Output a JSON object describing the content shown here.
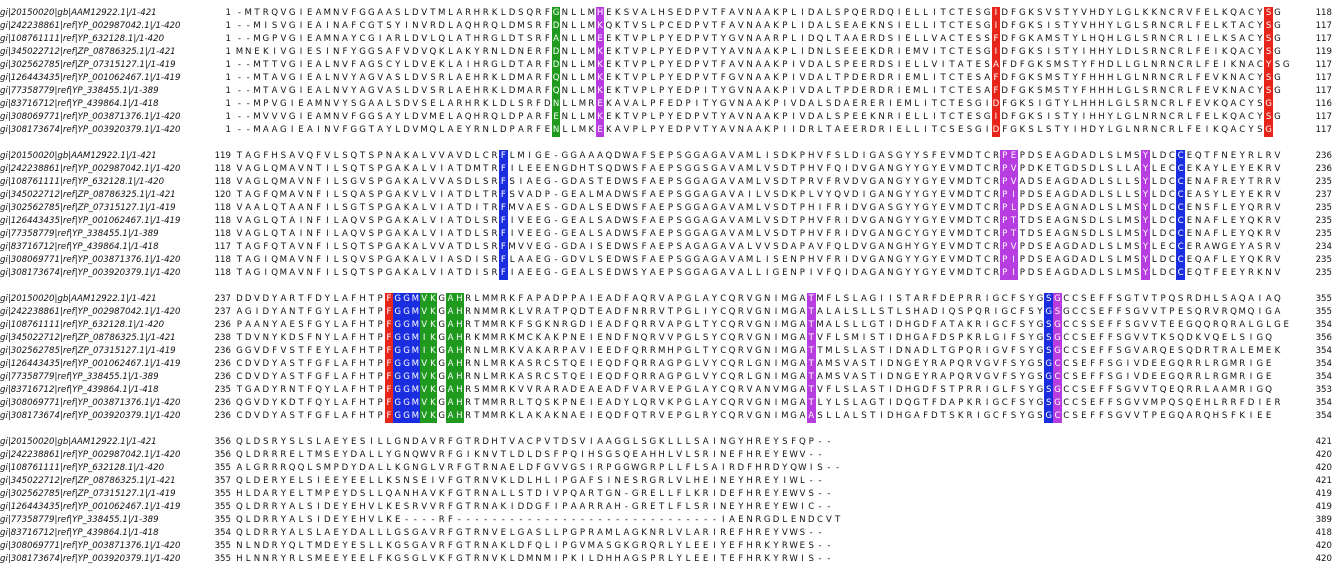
{
  "colors": {
    "background": "#ffffff",
    "text": "#111111",
    "highlight_text": "#ffffff",
    "conservation": {
      "R": "#e8251a",
      "D": "#e8251a",
      "E": "#e8251a",
      "C": "#e8251a",
      "F": "#1a2ee0",
      "Y": "#1a2ee0",
      "G": "#1f9a1f",
      "N": "#b73de0",
      "S": "#b73de0",
      "T": "#b73de0",
      "M": "#b73de0",
      "P": "#1a2ee0",
      "H": "#e8251a",
      "K": "#1f9a1f",
      "V": "#1f9a1f",
      "L": "#b73de0"
    }
  },
  "alignment": {
    "blocks": [
      {
        "highlight": [
          {
            "col": 36,
            "color": "#1f9a1f"
          },
          {
            "col": 41,
            "color": "#b73de0"
          },
          {
            "col": 86,
            "color": "#e8251a"
          },
          {
            "col": 117,
            "color": "#e8251a"
          }
        ],
        "rows": [
          {
            "name": "gi|20150020|gb|AAM12922.1|/1-421",
            "start": "1",
            "seq": "-MTRQVGIEAMNVFGGAASLDVTMLARHRKLDSQRFGNLLMHEKSVALHSEDPVTFAVNAAKPLIDALSPQERDQIELLITCTESGIDFGKSVSTYVHDYLGLKKNCRVFELKQACYSG",
            "end": "118"
          },
          {
            "name": "gi|242238861|ref|YP_002987042.1|/1-420",
            "start": "1",
            "seq": "--MISVGIEAINAFCGTSYINVRDLAQHRQLDMSRFDNLLMKQKTVSLPCEDPVTFAVNAAKPLIDALSEAEKNSIELLITCTESGIDFGKSISTYVHHYLGLSRNCRLFELKTACYSG",
            "end": "117"
          },
          {
            "name": "gi|108761111|ref|YP_632128.1|/1-420",
            "start": "1",
            "seq": "--MGPVGIEAMNAYCGIARLDVLQLATHRGLDTSRFANLLMEEKTVPLPYEDPVTYGVNAARPLIDQLTAAERDSIELLVACTESSFDFGKAMSTYLHQHLGLSRNCRLIELKSACYSG",
            "end": "117"
          },
          {
            "name": "gi|345022712|ref|ZP_08786325.1|/1-421",
            "start": "1",
            "seq": "MNEKIVGIESINFYGGSAFVDVQKLAKYRNLDNERFDNLLMKEKTVPLPYEDPVTYAVNAAKPLIDNLSEEEKDRIEMVITCTESGIDFGKSISTYIHHYLDLSRNCRLFEIKQACYSG",
            "end": "119"
          },
          {
            "name": "gi|302562785|ref|ZP_07315127.1|/1-419",
            "start": "1",
            "seq": "--MTTVGIEALNVFAGSCYLDVEKLAIHRGLDTARFDNLLMKEKTVPLPYEDPVTFAVNAAKPIVDALSPEERDSIELLVITATESAFDFGKSMSTYFHDLLGLNRNCRLFEIKNACYSG",
            "end": "117"
          },
          {
            "name": "gi|126443435|ref|YP_001062467.1|/1-419",
            "start": "1",
            "seq": "--MTAVGIEALNVYAGVASLDVSRLAEHRKLDMARFQNLLMKEKTVPLPYEDPVTFGVNAAKPIVDALTPDERDRIEMLITCTESAFDFGKSMSTYFHHHLGLNRNCRLFEVKNACYSG",
            "end": "117"
          },
          {
            "name": "gi|77358779|ref|YP_338455.1|/1-389",
            "start": "1",
            "seq": "--MTAVGIEALNVYAGVASLDVSRLAEHRKLDMARFQNLLMKEKTVPLPYEDPITYGVNAAKPIVDALTPDERDRIEMLITCTESAFDFGKSMSTYFHHHLGLSRNCRLFEVKNACYSG",
            "end": "117"
          },
          {
            "name": "gi|83716712|ref|YP_439864.1|/1-418",
            "start": "1",
            "seq": "--MPVGIEAMNVYSGAALSDVSELARHRKLDLSRFDNLLMREKAVALPFEDPITYGVNAAKPIVDALSDAERERIEMLITCTESGIDFGKSIGTYLHHHLGLSRNCRLFEVKQACYSG",
            "end": "116"
          },
          {
            "name": "gi|308069771|ref|YP_003871376.1|/1-420",
            "start": "1",
            "seq": "--MVVVGIEAMNVFGGSAYLDVMELAQHRQLDPARFENLLMKEKTVPLPYEDPVTYAVNAAKPIVDALSPEEKNRIELLITCTESGIDFGKSISTYIHHYLGLNRNCRLFELKQACYSG",
            "end": "117"
          },
          {
            "name": "gi|308173674|ref|YP_003920379.1|/1-420",
            "start": "1",
            "seq": "--MAAGIEAINVFGGTAYLDVMQLAEYRNLDPARFENLLMKEKAVPLPYEDPVTYAVNAAKPIIDRLTAEERDRIELLITCSESGIDFGKSLSTYIHDYLGLNRNCRLFEIKQACYSG",
            "end": "117"
          }
        ]
      },
      {
        "highlight": [
          {
            "col": 30,
            "color": "#1a2ee0"
          },
          {
            "col": 87,
            "color": "#b73de0"
          },
          {
            "col": 88,
            "color": "#b73de0"
          },
          {
            "col": 103,
            "color": "#b73de0"
          },
          {
            "col": 107,
            "color": "#1a2ee0"
          }
        ],
        "rows": [
          {
            "name": "gi|20150020|gb|AAM12922.1|/1-421",
            "start": "119",
            "seq": "TAGFHSAVQFVLSQTSPNAKALVVAVDLCRFLMIGE-GGAAAQDWAFSEPSGGAGAVAMLISDKPHVFSLDIGASGYYSFEVMDTCRPEPDSEAGDADLSLMSYLDCCEQTFNEYRLRV",
            "end": "236"
          },
          {
            "name": "gi|242238861|ref|YP_002987042.1|/1-420",
            "start": "118",
            "seq": "VAGLQMAVNTILSQTSPGAKALVIATDMTRFILEEENGDHTSQDWSFAEPSGGSGAVAMLVSDTPHVFQIDVGANGYYGYEVMDTCRPVPDKETGDSDLSLLAYLECCEKAYLEYEKRV",
            "end": "236"
          },
          {
            "name": "gi|108761111|ref|YP_632128.1|/1-420",
            "start": "118",
            "seq": "VAGLQMAVNFILSGVSPGAKALVVASDLSRFSIAEG-GDASTEDWSFAEPSGGAGAVAMLVSDTPRVFRVDVGANGYYGYEVMDTCRPVADSEAGDADLSLLSYLDCCENAFREYTRRV",
            "end": "235"
          },
          {
            "name": "gi|345022712|ref|ZP_08786325.1|/1-421",
            "start": "120",
            "seq": "TAGFQMAVNFILSQASPGAKVLVIATDLTRFSVADP-GEALMADWSFAEPSGGAGAVAILVSDKPLVYQVDIGANGYYGYEVMDTCRPIPDSEAGDADLSLLSYLDCCEASYLEYEKRV",
            "end": "237"
          },
          {
            "name": "gi|302562785|ref|ZP_07315127.1|/1-419",
            "start": "118",
            "seq": "VAALQTAANFILSGTSPGAKALVIATDITRFMVAES-GDALSEDWSFAEPSGGAGAVAMLVSDTPHIFRIDVGASGYYGYEVMDTCRPLPDSEAGNADLSLMSYLDCCENSFLEYQRRV",
            "end": "235"
          },
          {
            "name": "gi|126443435|ref|YP_001062467.1|/1-419",
            "start": "118",
            "seq": "VAGLQTAINFILAQVSPGAKALVIATDLSRFIVEEG-GEALSADWSFAEPSGGAGAVAMLVSDTPHVFRIDVGANGYYGYEVMDTCRPTTDSEAGNSDLSLMSYLDCCENAFLEYQKRV",
            "end": "235"
          },
          {
            "name": "gi|77358779|ref|YP_338455.1|/1-389",
            "start": "118",
            "seq": "VAGLQTAINFILAQVSPGAKALVIATDLSRFIVEEG-GEALSADWSFAEPSGGAGAVAMLVSDTPHVFRIDVGANGCYGYEVMDTCRPTTDSEAGNSDLSLMSYLDCCENAFLEYQKRV",
            "end": "235"
          },
          {
            "name": "gi|83716712|ref|YP_439864.1|/1-418",
            "start": "117",
            "seq": "TAGFQTAVNFILSQTSPGAKALVVATDLSRFMVVEG-GDAISEDWSFAEPSAGAGAVALVVSDAPAVFQLDVGANGHYGYEVMDTCRPVPDSEAGDADLSLMSYLECCERAWGEYASRV",
            "end": "234"
          },
          {
            "name": "gi|308069771|ref|YP_003871376.1|/1-420",
            "start": "118",
            "seq": "TAGIQMAVNFILSQVSPGAKALVIASDISRFLAAEG-GDVLSEDWSFAEPSGGAGAVAMLISENPHVFRIDVGANGYYGYEVMDTCRPIPDSEAGDADLSLMSYLDCCEQAFLEYQKRV",
            "end": "235"
          },
          {
            "name": "gi|308173674|ref|YP_003920379.1|/1-420",
            "start": "118",
            "seq": "TAGIQMAVNFILSQTSPGAKALVIATDISRFIAEEG-GEALSEDWSYAEPSGGAGAVALLIGENPIVFQIDAGANGYYGYEVMDTCRPIPDSEAGDADLSLMSYLDCCEQTFEEYRKNV",
            "end": "235"
          }
        ]
      },
      {
        "highlight": [
          {
            "col": 17,
            "color": "#e8251a"
          },
          {
            "col": 18,
            "color": "#1a2ee0"
          },
          {
            "col": 19,
            "color": "#1a2ee0"
          },
          {
            "col": 20,
            "color": "#1a2ee0"
          },
          {
            "col": 21,
            "color": "#1f9a1f"
          },
          {
            "col": 22,
            "color": "#1f9a1f"
          },
          {
            "col": 24,
            "color": "#1f9a1f"
          },
          {
            "col": 25,
            "color": "#1f9a1f"
          },
          {
            "col": 65,
            "color": "#b73de0"
          },
          {
            "col": 92,
            "color": "#1a2ee0"
          },
          {
            "col": 93,
            "color": "#b73de0"
          }
        ],
        "rows": [
          {
            "name": "gi|20150020|gb|AAM12922.1|/1-421",
            "start": "237",
            "seq": "DDVDYARTFDYLAFHTPFGGMVKGAHRLMMRKFAPADPPAIEADFAQRVAPGLAYCQRVGNIMGATMFLSLAGIISTARFDEPRRIGCFSYGSGCCSEFFSGTVTPQSRDHLSAQAIAQ",
            "end": "355"
          },
          {
            "name": "gi|242238861|ref|YP_002987042.1|/1-420",
            "start": "237",
            "seq": "AGIDYANTFGYLAFHTPFGGMVKGAHRNMMRKLVRATPQDTEADFNRRVTPGLIYCQRVGNIMGATALALSLLSTLSHADIQSPQRIGCFSYGSGCCSEFFSGVVTPESQRVRQMQIGA",
            "end": "355"
          },
          {
            "name": "gi|108761111|ref|YP_632128.1|/1-420",
            "start": "236",
            "seq": "PAANYAESFGYLAFHTPFGGMVKGAHRTMMRKFSGKNRGDIEADFQRRVAPGLTYCQRVGNIMGATMALSLLGTIDHGDFATAKRIGCFSYGSGCCSSEFFSGVVTEEGQQRQRALGLGE",
            "end": "354"
          },
          {
            "name": "gi|345022712|ref|ZP_08786325.1|/1-421",
            "start": "238",
            "seq": "TDVNYKDSFNYLAFHTPFGGMIKGAHRKMMRKMCKAKPNEIENDFNQRVVPGLSYCQRVGNIMGATVFLSMISTIDHGAFDSPKRLGIFSYGSGCCSEFFSGVVTKSQDKVQELSIGQ",
            "end": "356"
          },
          {
            "name": "gi|302562785|ref|ZP_07315127.1|/1-419",
            "start": "236",
            "seq": "GGVDFVSTFEYLAFHTPFGGMIKGAHRNLMRKVAKARPAVIEEDFQRRMHPGLTYCQRVGNIMGATTMLSLASTIDNADLTGPQRIGVFSYGSGCCSEFFSGVARQESQDRTRALEMEK",
            "end": "354"
          },
          {
            "name": "gi|126443435|ref|YP_001062467.1|/1-419",
            "start": "236",
            "seq": "CDVDYASTFGFLAFHTPFGGMVKGAHRNLMRKASRCSTQEIEQDFQRRAGPGLVYCQRLGNIMGATAMSVASTIDNGEYRAPQRVGVFSYGSGCCSEFFSGIVDEEGQRRLRGMRIGE",
            "end": "354"
          },
          {
            "name": "gi|77358779|ref|YP_338455.1|/1-389",
            "start": "236",
            "seq": "CDVDYASTFGFLAFHTPFGGMVKGAHRNLMRKASRCSTQEIEQDFQRRAGPGLVYCQRLGNIMGATAMSVASTIDNGEYRAPQRVGVFSYGSGCCSEFFSGIVDEEGQRRLRGMRIGE",
            "end": "354"
          },
          {
            "name": "gi|83716712|ref|YP_439864.1|/1-418",
            "start": "235",
            "seq": "TGADYRNTFQYLAFHTPFGGMVKGAHRSMMRKVVRARADEAEADFVARVEPGLAYCQRVANVMGATVFLSLASTIDHGDFSTPRRIGLFSYGSGCCSEFFSGVVTQEQRRLAAMRIGQ",
            "end": "353"
          },
          {
            "name": "gi|308069771|ref|YP_003871376.1|/1-420",
            "start": "236",
            "seq": "QGVDYKDTFQYLAFHTPFGGMVKGAHRTMMRRLTQSKPNEIEADYLQRVKPGLAYCQRVGNIMGATLYLSLAGTIDQGTFDAPKRIGCFSYGSGCCSEFFSGVVMPQSQEHLRRFDIER",
            "end": "354"
          },
          {
            "name": "gi|308173674|ref|YP_003920379.1|/1-420",
            "start": "236",
            "seq": "CDVDYASTFGFLAFHTPFGGMVKGAHRTMMRKLAKAKNAEIEQDFQTRVEPGLRYCQRVGNIMGAASLLALSTIDHGAFDTSKRIGCFSYGSGCCSEFFSGVVTPEGQARQHSFKIEE",
            "end": "354"
          }
        ]
      },
      {
        "highlight": [],
        "rows": [
          {
            "name": "gi|20150020|gb|AAM12922.1|/1-421",
            "start": "356",
            "seq": "QLDSRYSLSLAEYESILLGNDAVRFGTRDHTVACPVTDSVIAAGGLSGKLLLSAINGYHREYSFQP--",
            "end": "421"
          },
          {
            "name": "gi|242238861|ref|YP_002987042.1|/1-420",
            "start": "356",
            "seq": "QLDRRRELTMSEYDALLYGNQWVRFGIKNVTLDLDSFPQIHSGSQEAHHLVLSRINEFHREYEWV--",
            "end": "420"
          },
          {
            "name": "gi|108761111|ref|YP_632128.1|/1-420",
            "start": "355",
            "seq": "ALGRRRQQLSMPDYDALLKGNGLVRFGTRNAELDFGVVGSIRPGGWGRPLLFLSAIRDFHRDYQWIS--",
            "end": "420"
          },
          {
            "name": "gi|345022712|ref|ZP_08786325.1|/1-421",
            "start": "357",
            "seq": "QLDERYELSIEEYEELLKSNSEIVFGTRNVKLDLHLIPGAFSINESRGRLVLHEINEYHREYIWL--",
            "end": "421"
          },
          {
            "name": "gi|302562785|ref|ZP_07315127.1|/1-419",
            "start": "355",
            "seq": "HLDARYELTMPEYDSLLQANHAVKFGTRNALLSTDIVPQARTGN-GRELLFLKRIDEFHREYEWVS--",
            "end": "419"
          },
          {
            "name": "gi|126443435|ref|YP_001062467.1|/1-419",
            "start": "355",
            "seq": "QLDRRYALSIDEYEHVLKESRVVRFGTRNAKIDDGFIPAARRAH-GRETLFLSRINEYHREYEWIC--",
            "end": "419"
          },
          {
            "name": "gi|77358779|ref|YP_338455.1|/1-389",
            "start": "355",
            "seq": "QLDRRYALSIDEYEHVLKE----RF------------------------------IAENRGDLENDCVT",
            "end": "389"
          },
          {
            "name": "gi|83716712|ref|YP_439864.1|/1-418",
            "start": "354",
            "seq": "QLDRRYALSLAEYDALLLGSGAVRFGTRNVELGASLLPGPRAMLAGKNRLVLARIREFHREYVWS--",
            "end": "418"
          },
          {
            "name": "gi|308069771|ref|YP_003871376.1|/1-420",
            "start": "355",
            "seq": "NLNDRYQLTMDEYESLLKGSGAVRFGTRNAKLDFQLIPGVMASGKGRQRLYLEEIYEFHRKYRWES--",
            "end": "420"
          },
          {
            "name": "gi|308173674|ref|YP_003920379.1|/1-420",
            "start": "355",
            "seq": "HLNNRYRLSMEEYEELFKGSGLVKFGTRNVKLDMNMIPKILDHHAGSPRLYLEEITEFHRKYRWIS--",
            "end": "420"
          }
        ]
      }
    ]
  }
}
